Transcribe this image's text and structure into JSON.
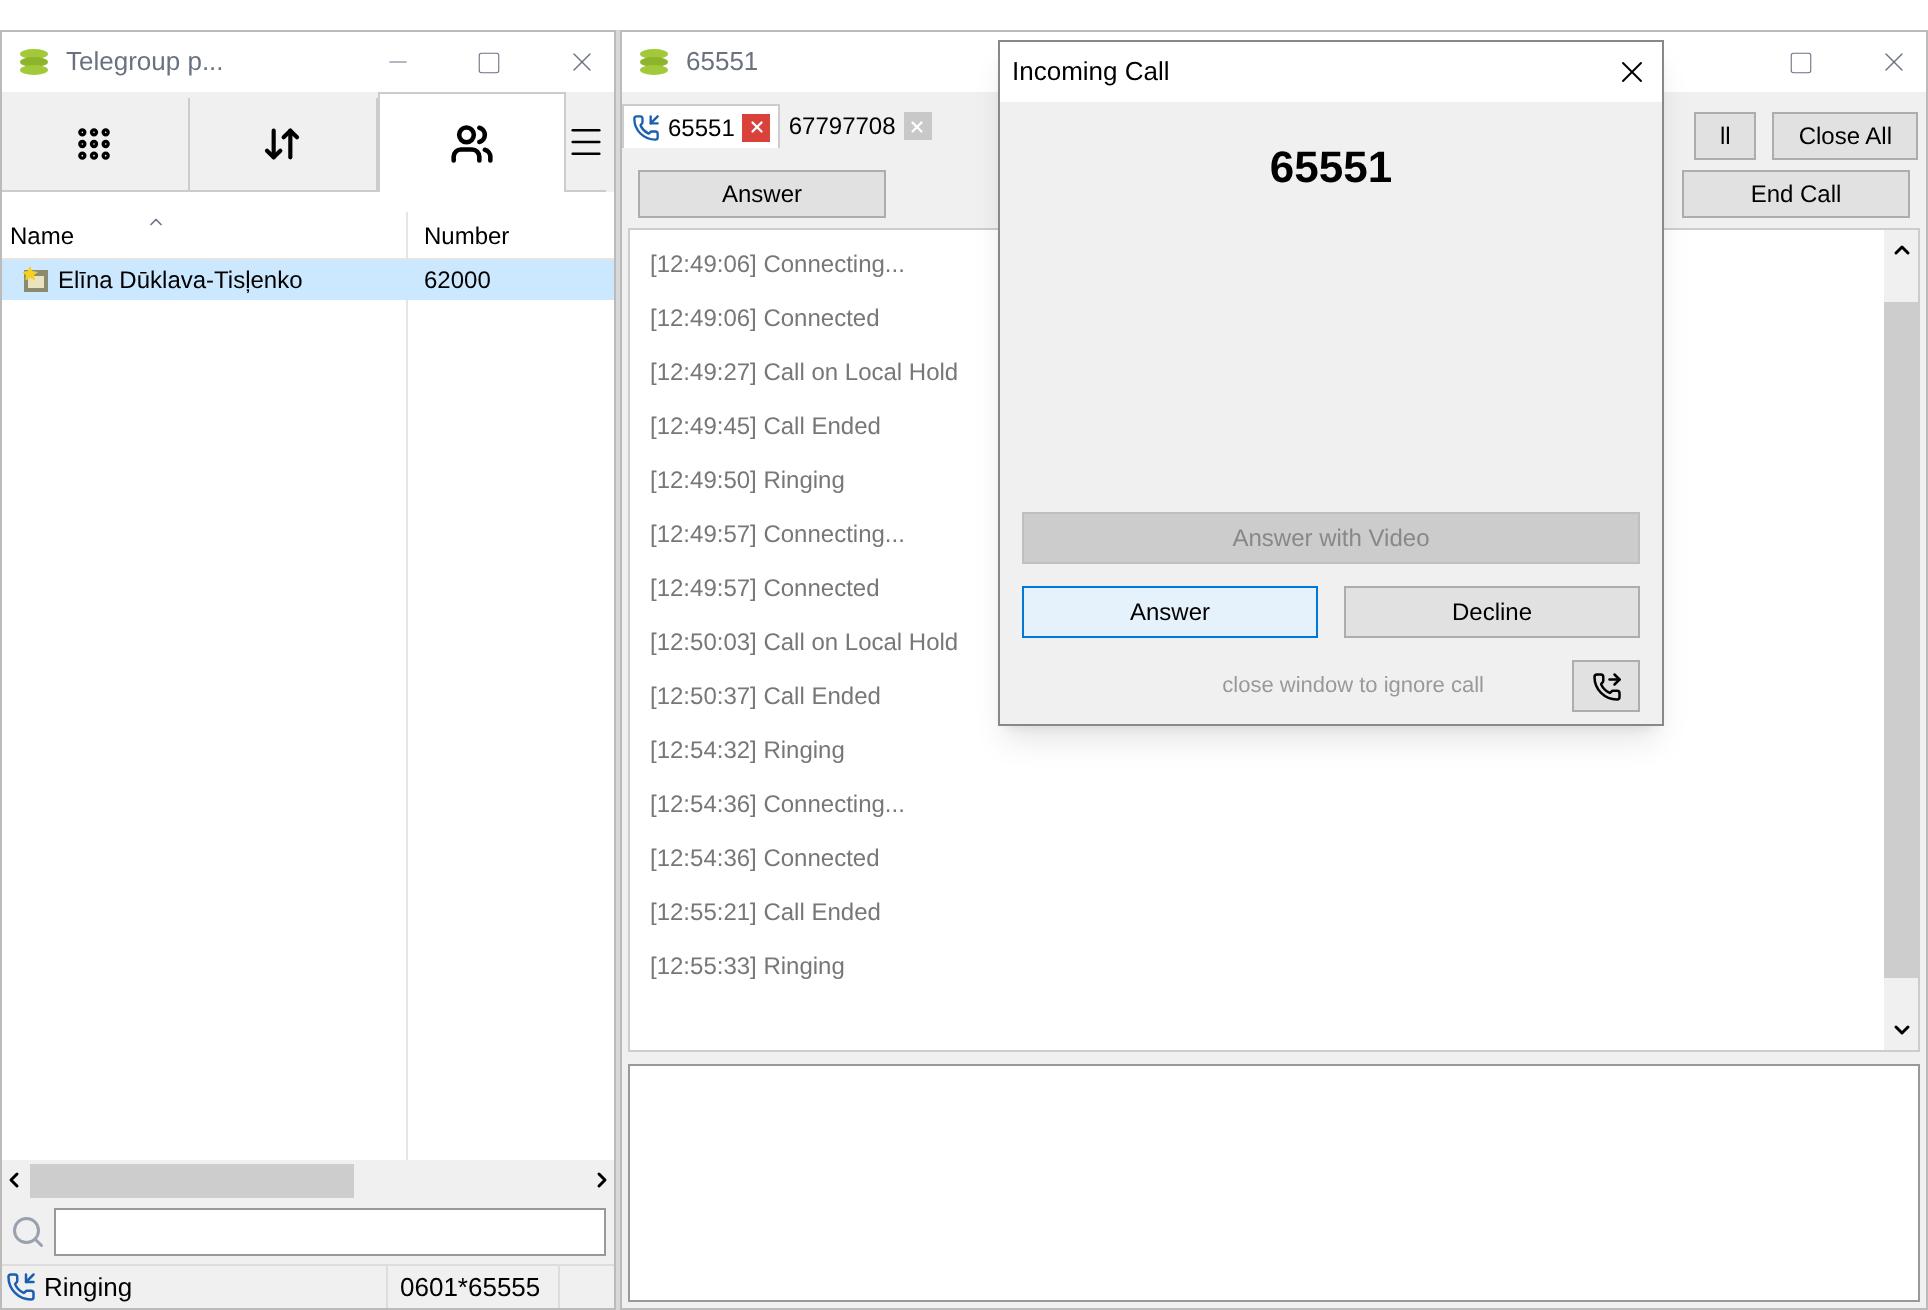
{
  "left_window": {
    "title": "Telegroup p...",
    "tabs": [
      {
        "kind": "keypad",
        "selected": false
      },
      {
        "kind": "transfer",
        "selected": false
      },
      {
        "kind": "contacts",
        "selected": true
      }
    ],
    "columns": [
      "Name",
      "Number"
    ],
    "rows": [
      {
        "name": "Elīna Dūklava-Tisļenko",
        "number": "62000",
        "selected": true
      }
    ],
    "status": {
      "text": "Ringing",
      "number": "0601*65555"
    }
  },
  "call_window": {
    "title": "65551",
    "tabs": [
      {
        "label": "65551",
        "selected": true
      },
      {
        "label": "67797708",
        "selected": false
      }
    ],
    "top_buttons": [
      "ll",
      "Close All"
    ],
    "answer_button": "Answer",
    "end_button": "End Call",
    "log": [
      "[12:49:06] Connecting...",
      "[12:49:06] Connected",
      "[12:49:27] Call on Local Hold",
      "[12:49:45] Call Ended",
      "[12:49:50] Ringing",
      "[12:49:57] Connecting...",
      "[12:49:57] Connected",
      "[12:50:03] Call on Local Hold",
      "[12:50:37] Call Ended",
      "[12:54:32] Ringing",
      "[12:54:36] Connecting...",
      "[12:54:36] Connected",
      "[12:55:21] Call Ended",
      "[12:55:33] Ringing"
    ]
  },
  "dialog": {
    "title": "Incoming Call",
    "number": "65551",
    "video_button": {
      "label": "Answer with Video",
      "disabled": true
    },
    "answer_button": "Answer",
    "decline_button": "Decline",
    "hint": "close window to ignore call"
  }
}
